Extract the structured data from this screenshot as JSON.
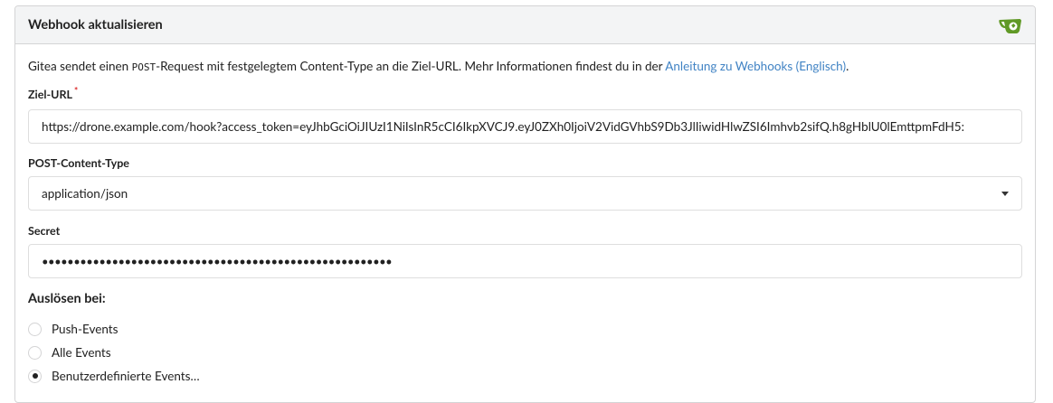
{
  "header": {
    "title": "Webhook aktualisieren",
    "logo_icon": "gitea-logo-icon"
  },
  "description": {
    "before": "Gitea sendet einen ",
    "code": "POST",
    "after": "-Request mit festgelegtem Content-Type an die Ziel-URL. Mehr Informationen findest du in der ",
    "link": "Anleitung zu Webhooks (Englisch)",
    "end": "."
  },
  "target_url": {
    "label": "Ziel-URL",
    "required_mark": "*",
    "value": "https://drone.example.com/hook?access_token=eyJhbGciOiJIUzI1NiIsInR5cCI6IkpXVCJ9.eyJ0ZXh0IjoiV2VidGVhbS9Db3JlIiwidHlwZSI6Imhvb2sifQ.h8gHblU0lEmttpmFdH5:"
  },
  "content_type": {
    "label": "POST-Content-Type",
    "value": "application/json"
  },
  "secret": {
    "label": "Secret",
    "value": "•••••••••••••••••••••••••••••••••••••••••••••••••••••••"
  },
  "trigger": {
    "title": "Auslösen bei:",
    "options": [
      {
        "label": "Push-Events",
        "checked": false
      },
      {
        "label": "Alle Events",
        "checked": false
      },
      {
        "label": "Benutzerdefinierte Events…",
        "checked": true
      }
    ]
  },
  "colors": {
    "link": "#4183c4",
    "required": "#db2828",
    "logo": "#609926"
  }
}
